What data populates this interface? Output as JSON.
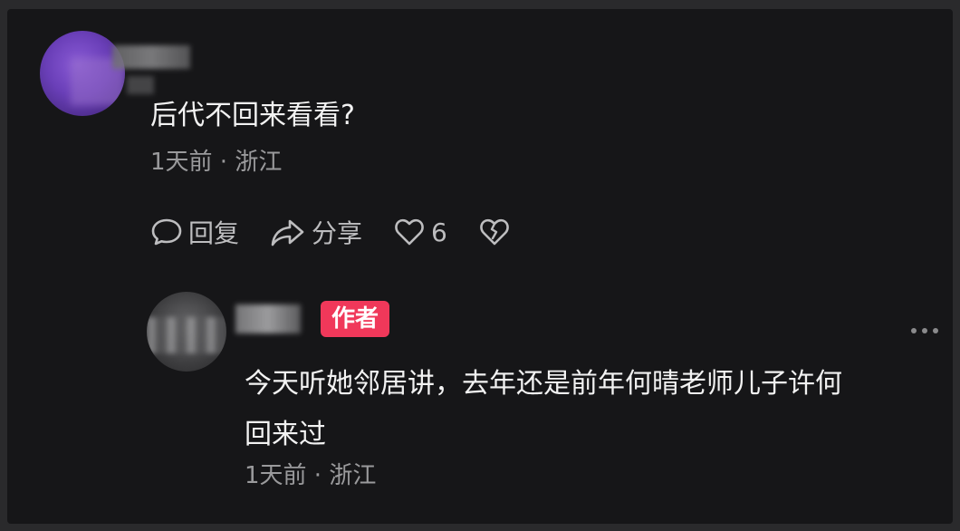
{
  "comments": [
    {
      "text": "后代不回来看看?",
      "meta": "1天前 · 浙江",
      "actions": {
        "reply_label": "回复",
        "share_label": "分享",
        "like_count": "6"
      }
    },
    {
      "badge": "作者",
      "text_line1": "今天听她邻居讲，去年还是前年何晴老师儿子许何",
      "text_line2": "回来过",
      "meta": "1天前 · 浙江"
    }
  ],
  "icons": {
    "reply": "comment-bubble-icon",
    "share": "share-arrow-icon",
    "like": "heart-icon",
    "dislike": "broken-heart-icon",
    "more": "more-dots-icon"
  },
  "colors": {
    "background": "#161618",
    "text": "#f2f2f2",
    "meta": "#9a9a9c",
    "badge": "#f0385a"
  }
}
